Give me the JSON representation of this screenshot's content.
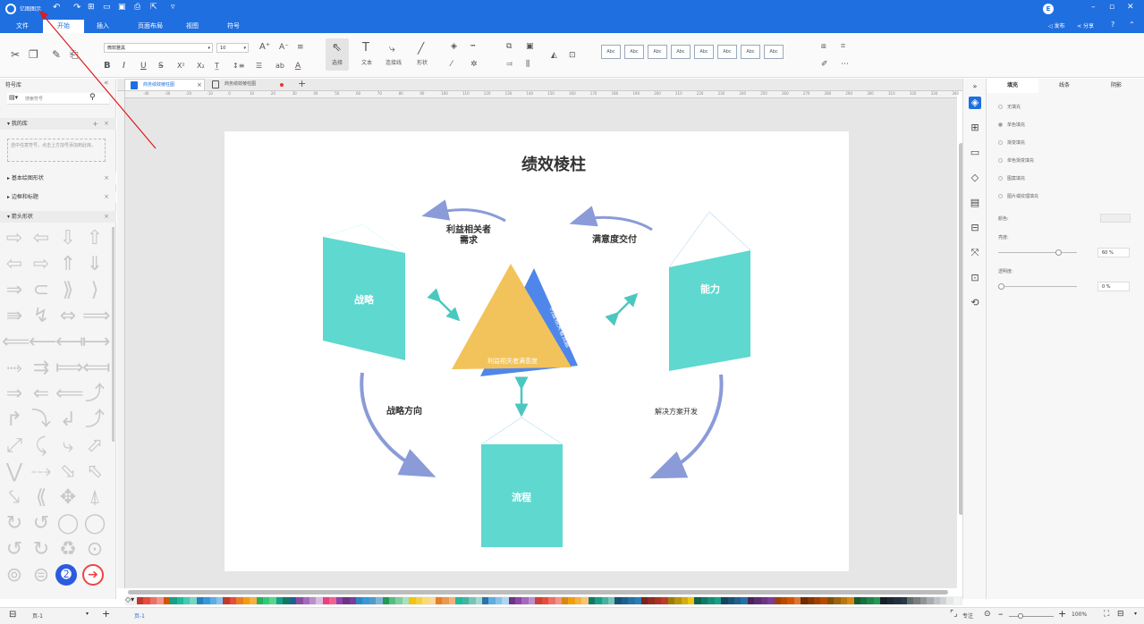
{
  "titlebar": {
    "app_name": "亿图图示"
  },
  "menu": {
    "items": [
      "文件",
      "开始",
      "插入",
      "页面布局",
      "视图",
      "符号"
    ]
  },
  "ribbon": {
    "font_name": "微软雅黑",
    "font_size": "10",
    "tools": [
      "选择",
      "文本",
      "连接线",
      "形状"
    ],
    "style_label": "Abc"
  },
  "left": {
    "title": "符号库",
    "search_placeholder": "搜索符号",
    "my_lib": "我的库",
    "my_lib_hint": "选中任意符号，点击上方加号添加到此库。",
    "sections": [
      "基本绘图形状",
      "边框和标题",
      "箭头形状"
    ]
  },
  "tabs": {
    "items": [
      "商务绩效棱柱图",
      "商务绩效棱柱图"
    ]
  },
  "ruler": {
    "ticks": [
      "-40",
      "-30",
      "-20",
      "-10",
      "0",
      "10",
      "20",
      "30",
      "40",
      "50",
      "60",
      "70",
      "80",
      "90",
      "100",
      "110",
      "120",
      "130",
      "140",
      "150",
      "160",
      "170",
      "180",
      "190",
      "200",
      "210",
      "220",
      "230",
      "240",
      "250",
      "260",
      "270",
      "280",
      "290",
      "300",
      "310",
      "320",
      "330",
      "340"
    ]
  },
  "diagram": {
    "title": "绩效棱柱",
    "strategy": "战略",
    "capability": "能力",
    "process": "流程",
    "stakeholder_needs_1": "利益相关者",
    "stakeholder_needs_2": "需求",
    "satisfaction": "满意度交付",
    "strategic_direction": "战略方向",
    "solution_dev": "解决方案开发",
    "triangle_bottom": "利益相关者满意度",
    "triangle_side": "利益相关者贡献",
    "colors": {
      "teal": "#5fd8cf",
      "yellow": "#f2c25b",
      "blue": "#4f86ea",
      "arrow": "#7f95d6",
      "teal_arrow": "#4ac8c0"
    }
  },
  "right": {
    "tabs": [
      "填充",
      "线条",
      "阴影"
    ],
    "options": [
      "无填充",
      "单色填充",
      "渐变填充",
      "单色渐变填充",
      "图案填充",
      "图片或纹理填充"
    ],
    "color_label": "颜色:",
    "brightness_label": "亮度:",
    "brightness_value": "60 %",
    "transparency_label": "透明度:",
    "transparency_value": "0 %"
  },
  "topright": {
    "publish": "发布",
    "share": "分享"
  },
  "status": {
    "page_selector": "页-1",
    "page_tab": "页-1",
    "focus": "专注",
    "zoom": "100%"
  },
  "palette_colors": [
    "#c0392b",
    "#e74c3c",
    "#ec7063",
    "#f1948a",
    "#d35400",
    "#16a085",
    "#1abc9c",
    "#48c9b0",
    "#76d7c4",
    "#2980b9",
    "#3498db",
    "#5dade2",
    "#85c1e9",
    "#c0392b",
    "#e74c3c",
    "#e67e22",
    "#f39c12",
    "#f5b041",
    "#27ae60",
    "#2ecc71",
    "#58d68d",
    "#16a085",
    "#117864",
    "#1f618d",
    "#884ea0",
    "#a569bd",
    "#bb8fce",
    "#d7bde2",
    "#ec407a",
    "#f06292",
    "#8e44ad",
    "#6c3483",
    "#7d3c98",
    "#2e86c1",
    "#3498db",
    "#5499c7",
    "#7fb3d5",
    "#229954",
    "#52be80",
    "#7dcea0",
    "#a9dfbf",
    "#f1c40f",
    "#f4d03f",
    "#f7dc6f",
    "#fad7a0",
    "#e67e22",
    "#eb984e",
    "#f0b27a",
    "#1abc9c",
    "#45b39d",
    "#73c6b6",
    "#a2d9ce",
    "#2874a6",
    "#5dade2",
    "#85c1e9",
    "#aed6f1",
    "#6c3483",
    "#8e44ad",
    "#a569bd",
    "#bb8fce",
    "#cb4335",
    "#e74c3c",
    "#ec7063",
    "#f1948a",
    "#d68910",
    "#f39c12",
    "#f5b041",
    "#f8c471",
    "#117a65",
    "#16a085",
    "#45b39d",
    "#73c6b6",
    "#1a5276",
    "#1f618d",
    "#2471a3",
    "#2980b9",
    "#7b241c",
    "#922b21",
    "#a93226",
    "#c0392b",
    "#9a7d0a",
    "#b7950b",
    "#d4ac0d",
    "#f1c40f",
    "#0e6251",
    "#117864",
    "#138d75",
    "#16a085",
    "#154360",
    "#1a5276",
    "#1f618d",
    "#2471a3",
    "#4a235a",
    "#5b2c6f",
    "#6c3483",
    "#7d3c98",
    "#a04000",
    "#ba4a00",
    "#d35400",
    "#dc7633",
    "#6e2c00",
    "#873600",
    "#a04000",
    "#ba4a00",
    "#7e5109",
    "#9c640c",
    "#b9770e",
    "#d68910",
    "#145a32",
    "#196f3d",
    "#1e8449",
    "#229954",
    "#17202a",
    "#1c2833",
    "#212f3d",
    "#273746",
    "#616a6b",
    "#7b7d7d",
    "#909497",
    "#a6acaf",
    "#bdc3c7",
    "#d0d3d4",
    "#e5e7e9",
    "#f2f3f4"
  ]
}
